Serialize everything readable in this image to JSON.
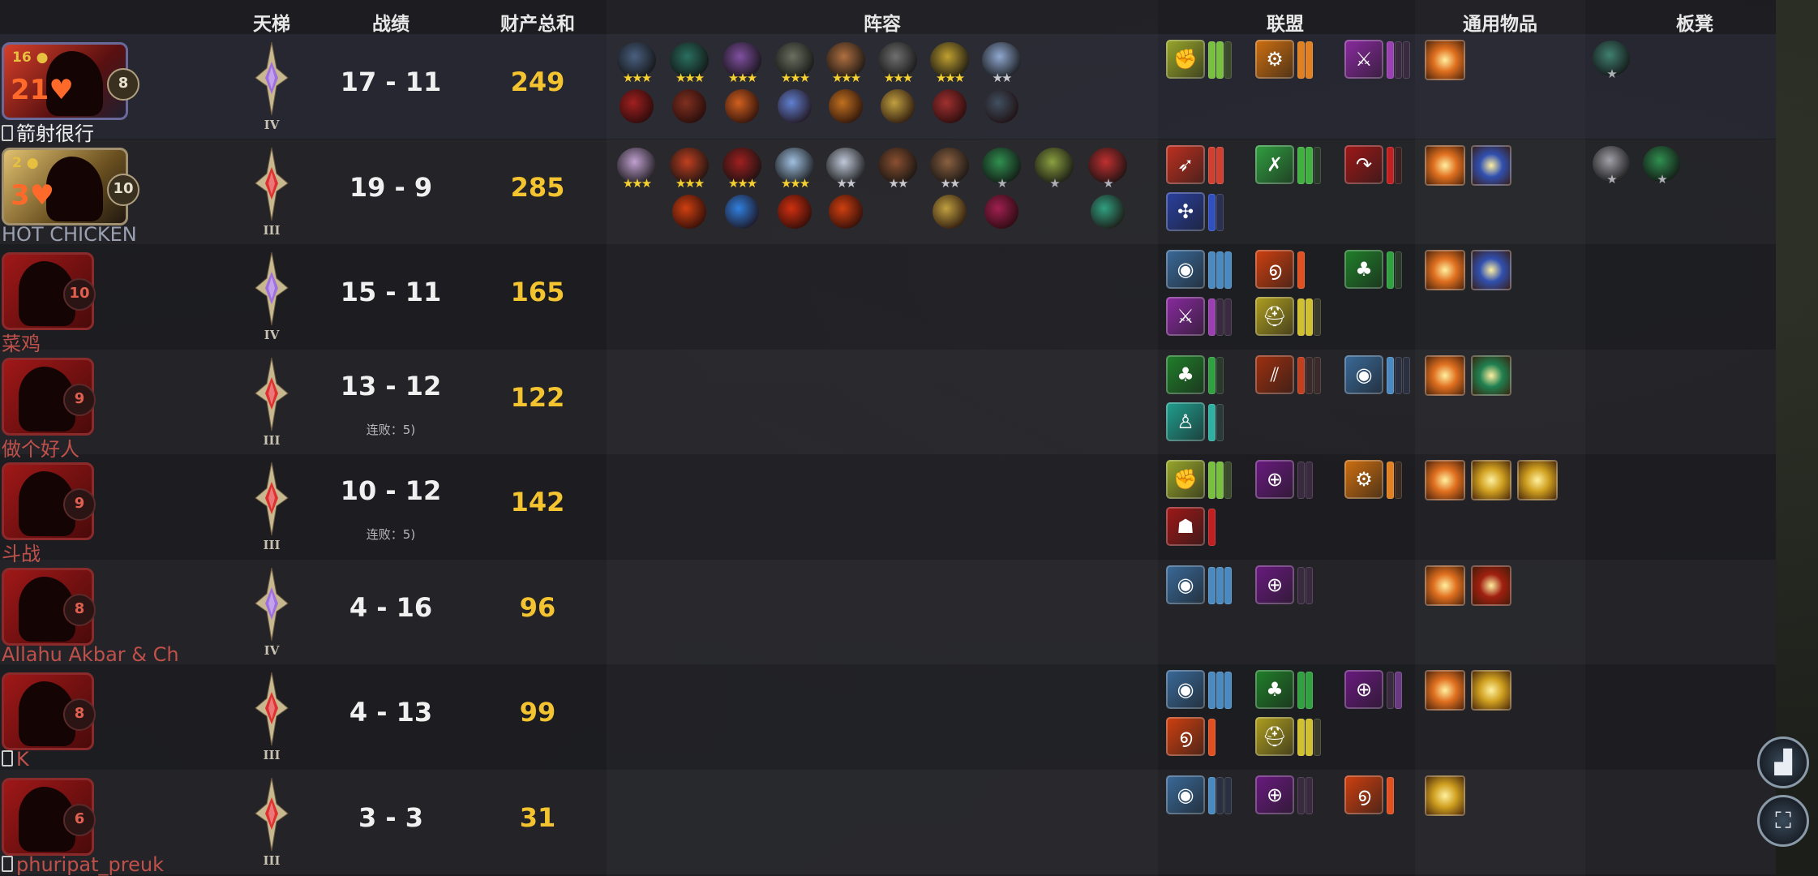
{
  "headers": {
    "ladder": "天梯",
    "record": "战绩",
    "networth": "财产总和",
    "lineup": "阵容",
    "alliances": "联盟",
    "common_items": "通用物品",
    "bench": "板凳"
  },
  "players": [
    {
      "name": "箭射很行",
      "name_color": "white",
      "phone": true,
      "gold": "16",
      "hp": "21",
      "level": "8",
      "rank_tier": "IV",
      "rank_color": "#a070e0",
      "record": "17 - 11",
      "streak": "",
      "networth": "249",
      "heroes": [
        {
          "icon": "hero-tusk",
          "stars": "★★★",
          "star_class": "g3",
          "color": "#4a6080"
        },
        {
          "icon": "hero-tidehunter",
          "stars": "★★★",
          "star_class": "g3",
          "color": "#2a7060"
        },
        {
          "icon": "hero-shadow-demon",
          "stars": "★★★",
          "star_class": "g3",
          "color": "#8050a0"
        },
        {
          "icon": "hero-tiny",
          "stars": "★★★",
          "star_class": "g3",
          "color": "#6a7060"
        },
        {
          "icon": "hero-techies",
          "stars": "★★★",
          "star_class": "g3",
          "color": "#b07040"
        },
        {
          "icon": "hero-clockwerk",
          "stars": "★★★",
          "star_class": "g3",
          "color": "#707070"
        },
        {
          "icon": "hero-gyrocopter",
          "stars": "★★★",
          "star_class": "g3",
          "color": "#c0a030"
        },
        {
          "icon": "hero-crystal-maiden",
          "stars": "★★",
          "star_class": "s2",
          "color": "#90a8d0"
        }
      ],
      "hero_items": [
        {
          "icon": "item-dagon",
          "color": "#a02020"
        },
        {
          "icon": "item-blademail",
          "color": "#803020"
        },
        {
          "icon": "item-radiance",
          "color": "#d06020"
        },
        {
          "icon": "item-eul",
          "color": "#6080d0"
        },
        {
          "icon": "item-armlet",
          "color": "#c07020"
        },
        {
          "icon": "item-scythe",
          "color": "#c0a040"
        },
        {
          "icon": "item-heart",
          "color": "#a03030"
        },
        {
          "icon": "item-helm",
          "color": "#405060"
        }
      ],
      "alliances": [
        {
          "icon": "fist-icon",
          "color": "#9aa82a",
          "glyph": "✊",
          "pips": [
            "#7ac040",
            "#7ac040",
            "#3a4a2a"
          ]
        },
        {
          "icon": "gear-icon",
          "color": "#d07010",
          "glyph": "⚙",
          "pips": [
            "#e08020",
            "#e08020"
          ]
        },
        {
          "icon": "crossed-swords-icon",
          "color": "#8a2aa0",
          "glyph": "⚔",
          "pips": [
            "#9a40b0",
            "#3a2a40",
            "#3a2a40"
          ]
        }
      ],
      "items": [
        {
          "icon": "item-fire-box",
          "color": "#e07020"
        }
      ],
      "bench": [
        {
          "icon": "bench-hero-troll",
          "color": "#408070",
          "stars": "★",
          "star_class": "s1"
        }
      ]
    },
    {
      "name": "HOT CHICKEN",
      "name_color": "grey",
      "phone": false,
      "gold": "2",
      "hp": "3",
      "level": "10",
      "rank_tier": "III",
      "rank_color": "#e03030",
      "record": "19 - 9",
      "streak": "",
      "networth": "285",
      "heroes": [
        {
          "icon": "hero-enchantress",
          "stars": "★★★",
          "star_class": "g3",
          "color": "#c0a0d0"
        },
        {
          "icon": "hero-lina",
          "stars": "★★★",
          "star_class": "g3",
          "color": "#c04020"
        },
        {
          "icon": "hero-doom",
          "stars": "★★★",
          "star_class": "g3",
          "color": "#a02020"
        },
        {
          "icon": "hero-drow",
          "stars": "★★★",
          "star_class": "g3",
          "color": "#a0c0e0"
        },
        {
          "icon": "hero-lich",
          "stars": "★★",
          "star_class": "s2",
          "color": "#c0c8d8"
        },
        {
          "icon": "hero-axe",
          "stars": "★★",
          "star_class": "s2",
          "color": "#8a5030"
        },
        {
          "icon": "hero-bounty",
          "stars": "★★",
          "star_class": "s2",
          "color": "#8a6040"
        },
        {
          "icon": "hero-venomancer",
          "stars": "★",
          "star_class": "s1",
          "color": "#309050"
        },
        {
          "icon": "hero-witch-doctor",
          "stars": "★",
          "star_class": "s1",
          "color": "#8aa040"
        },
        {
          "icon": "hero-kunkka",
          "stars": "★",
          "star_class": "s1",
          "color": "#c03030"
        }
      ],
      "hero_items": [
        {
          "icon": "",
          "color": ""
        },
        {
          "icon": "item-fire-orb",
          "color": "#d04010"
        },
        {
          "icon": "item-aghanim",
          "color": "#3080e0"
        },
        {
          "icon": "item-dagon",
          "color": "#d03010"
        },
        {
          "icon": "item-fire-orb",
          "color": "#d04010"
        },
        {
          "icon": "",
          "color": ""
        },
        {
          "icon": "item-scythe",
          "color": "#c0a040"
        },
        {
          "icon": "item-halberd",
          "color": "#a02050"
        },
        {
          "icon": "",
          "color": ""
        },
        {
          "icon": "item-mantle",
          "color": "#30a080"
        }
      ],
      "alliances": [
        {
          "icon": "bow-icon",
          "color": "#c03020",
          "glyph": "➶",
          "pips": [
            "#d04030",
            "#d04030"
          ]
        },
        {
          "icon": "axes-icon",
          "color": "#30a040",
          "glyph": "✗",
          "pips": [
            "#40b040",
            "#40b040",
            "#2a3a2a"
          ]
        },
        {
          "icon": "boot-icon",
          "color": "#a01818",
          "glyph": "↷",
          "pips": [
            "#c02020",
            "#3a2020"
          ]
        },
        {
          "icon": "fan-icon",
          "color": "#2a40a0",
          "glyph": "✣",
          "pips": [
            "#3050c0",
            "#2a3050"
          ]
        }
      ],
      "items": [
        {
          "icon": "item-fire-box",
          "color": "#e07020"
        },
        {
          "icon": "item-blue-figure",
          "color": "#3050b0"
        }
      ],
      "bench": [
        {
          "icon": "bench-hero-lich",
          "color": "#a0a0a8",
          "stars": "★",
          "star_class": "s1"
        },
        {
          "icon": "bench-hero-venomancer",
          "color": "#309050",
          "stars": "★",
          "star_class": "s1"
        }
      ]
    },
    {
      "name": "菜鸡",
      "name_color": "red",
      "phone": false,
      "gold": "",
      "hp": "",
      "level": "10",
      "rank_tier": "IV",
      "rank_color": "#a070e0",
      "record": "15 - 11",
      "streak": "",
      "networth": "165",
      "heroes": [],
      "hero_items": [],
      "alliances": [
        {
          "icon": "eye-icon",
          "color": "#3a6a9a",
          "glyph": "◉",
          "pips": [
            "#4a8ac0",
            "#4a8ac0",
            "#4a8ac0"
          ]
        },
        {
          "icon": "swirl-icon",
          "color": "#d04010",
          "glyph": "൭",
          "pips": [
            "#e05020"
          ]
        },
        {
          "icon": "leaf-icon",
          "color": "#20802a",
          "glyph": "♣",
          "pips": [
            "#30a040",
            "#2a3a2a"
          ]
        },
        {
          "icon": "crossed-swords-icon",
          "color": "#8a2aa0",
          "glyph": "⚔",
          "pips": [
            "#9a40b0",
            "#3a2a40",
            "#3a2a40"
          ]
        },
        {
          "icon": "helmet-icon",
          "color": "#b0a020",
          "glyph": "⛑",
          "pips": [
            "#d0c030",
            "#d0c030",
            "#3a3a2a"
          ]
        }
      ],
      "items": [
        {
          "icon": "item-fire-box",
          "color": "#e07020"
        },
        {
          "icon": "item-blue-figure",
          "color": "#3050b0"
        }
      ],
      "bench": []
    },
    {
      "name": "做个好人",
      "name_color": "red",
      "phone": false,
      "gold": "",
      "hp": "",
      "level": "9",
      "rank_tier": "III",
      "rank_color": "#e03030",
      "record": "13 - 12",
      "streak": "连败：5)",
      "networth": "122",
      "heroes": [],
      "hero_items": [],
      "alliances": [
        {
          "icon": "leaf-icon",
          "color": "#20802a",
          "glyph": "♣",
          "pips": [
            "#30a040",
            "#2a3a2a"
          ]
        },
        {
          "icon": "claw-icon",
          "color": "#a03010",
          "glyph": "⫽",
          "pips": [
            "#c04020",
            "#3a2a2a",
            "#3a2a2a"
          ]
        },
        {
          "icon": "eye-icon",
          "color": "#3a6a9a",
          "glyph": "◉",
          "pips": [
            "#4a8ac0",
            "#2a3040",
            "#2a3040"
          ]
        },
        {
          "icon": "human-icon",
          "color": "#20a090",
          "glyph": "♙",
          "pips": [
            "#30b0a0",
            "#2a3a3a"
          ]
        }
      ],
      "items": [
        {
          "icon": "item-fire-box",
          "color": "#e07020"
        },
        {
          "icon": "item-green-gem",
          "color": "#208050"
        }
      ],
      "bench": []
    },
    {
      "name": "斗战",
      "name_color": "red",
      "phone": false,
      "gold": "",
      "hp": "",
      "level": "9",
      "rank_tier": "III",
      "rank_color": "#e03030",
      "record": "10 - 12",
      "streak": "连败：5)",
      "networth": "142",
      "heroes": [],
      "hero_items": [],
      "alliances": [
        {
          "icon": "fist-icon",
          "color": "#9aa82a",
          "glyph": "✊",
          "pips": [
            "#7ac040",
            "#7ac040",
            "#3a4a2a"
          ]
        },
        {
          "icon": "target-icon",
          "color": "#6a1a80",
          "glyph": "⊕",
          "pips": [
            "#3a2a40",
            "#3a2a40"
          ]
        },
        {
          "icon": "gear-icon",
          "color": "#d07010",
          "glyph": "⚙",
          "pips": [
            "#e08020",
            "#3a2a20"
          ]
        },
        {
          "icon": "demon-icon",
          "color": "#a01818",
          "glyph": "☗",
          "pips": [
            "#c02020"
          ]
        }
      ],
      "items": [
        {
          "icon": "item-fire-box",
          "color": "#e07020"
        },
        {
          "icon": "item-gold-box",
          "color": "#d0a020"
        },
        {
          "icon": "item-gold-box",
          "color": "#d0a020"
        }
      ],
      "bench": []
    },
    {
      "name": "Allahu Akbar & Ch",
      "name_color": "red",
      "phone": false,
      "gold": "",
      "hp": "",
      "level": "8",
      "rank_tier": "IV",
      "rank_color": "#a070e0",
      "record": "4 - 16",
      "streak": "",
      "networth": "96",
      "heroes": [],
      "hero_items": [],
      "alliances": [
        {
          "icon": "eye-icon",
          "color": "#3a6a9a",
          "glyph": "◉",
          "pips": [
            "#4a8ac0",
            "#4a8ac0",
            "#4a8ac0"
          ]
        },
        {
          "icon": "target-icon",
          "color": "#6a1a80",
          "glyph": "⊕",
          "pips": [
            "#3a2a40",
            "#3a2a40"
          ]
        }
      ],
      "items": [
        {
          "icon": "item-fire-box",
          "color": "#e07020"
        },
        {
          "icon": "item-red-burst",
          "color": "#a02010"
        }
      ],
      "bench": []
    },
    {
      "name": "K",
      "name_color": "red",
      "phone": true,
      "gold": "",
      "hp": "",
      "level": "8",
      "rank_tier": "III",
      "rank_color": "#e03030",
      "record": "4 - 13",
      "streak": "",
      "networth": "99",
      "heroes": [],
      "hero_items": [],
      "alliances": [
        {
          "icon": "eye-icon",
          "color": "#3a6a9a",
          "glyph": "◉",
          "pips": [
            "#4a8ac0",
            "#4a8ac0",
            "#4a8ac0"
          ]
        },
        {
          "icon": "leaf-icon",
          "color": "#20802a",
          "glyph": "♣",
          "pips": [
            "#30a040",
            "#30a040"
          ]
        },
        {
          "icon": "target-icon",
          "color": "#6a1a80",
          "glyph": "⊕",
          "pips": [
            "#3a2a40",
            "#6a3a80"
          ]
        },
        {
          "icon": "swirl-icon",
          "color": "#d04010",
          "glyph": "൭",
          "pips": [
            "#e05020"
          ]
        },
        {
          "icon": "helmet-icon",
          "color": "#b0a020",
          "glyph": "⛑",
          "pips": [
            "#d0c030",
            "#d0c030",
            "#3a3a2a"
          ]
        }
      ],
      "items": [
        {
          "icon": "item-fire-box",
          "color": "#e07020"
        },
        {
          "icon": "item-gold-box",
          "color": "#d0a020"
        }
      ],
      "bench": []
    },
    {
      "name": "phuripat_preuk",
      "name_color": "red",
      "phone": true,
      "gold": "",
      "hp": "",
      "level": "6",
      "rank_tier": "III",
      "rank_color": "#e03030",
      "record": "3 - 3",
      "streak": "",
      "networth": "31",
      "heroes": [],
      "hero_items": [],
      "alliances": [
        {
          "icon": "eye-icon",
          "color": "#3a6a9a",
          "glyph": "◉",
          "pips": [
            "#4a8ac0",
            "#2a3040",
            "#2a3040"
          ]
        },
        {
          "icon": "target-icon",
          "color": "#6a1a80",
          "glyph": "⊕",
          "pips": [
            "#3a2a40",
            "#3a2a40"
          ]
        },
        {
          "icon": "swirl-icon",
          "color": "#d04010",
          "glyph": "൭",
          "pips": [
            "#e05020"
          ]
        }
      ],
      "items": [
        {
          "icon": "item-gold-box",
          "color": "#d0a020"
        }
      ],
      "bench": []
    }
  ],
  "side_buttons": [
    {
      "icon": "bar-chart-icon",
      "glyph": "▟"
    },
    {
      "icon": "map-icon",
      "glyph": "⛶"
    }
  ]
}
